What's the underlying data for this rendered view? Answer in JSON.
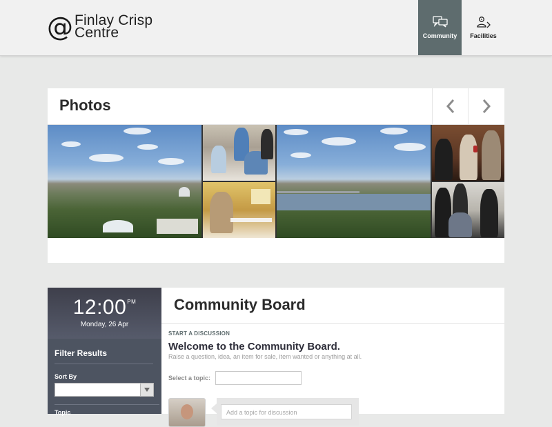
{
  "header": {
    "logo_symbol": "@",
    "logo_line1": "Finlay Crisp",
    "logo_line2": "Centre",
    "nav": [
      {
        "label": "Community",
        "icon": "speech-bubbles-icon",
        "active": true
      },
      {
        "label": "Facilities",
        "icon": "person-pin-icon",
        "active": false
      }
    ]
  },
  "photos": {
    "title": "Photos",
    "prev_icon": "chevron-left-icon",
    "next_icon": "chevron-right-icon"
  },
  "sidebar": {
    "time": "12:00",
    "ampm": "PM",
    "date": "Monday, 26 Apr",
    "filter_title": "Filter Results",
    "sort_by_label": "Sort By",
    "sort_by_value": "",
    "topic_label": "Topic"
  },
  "board": {
    "title": "Community Board",
    "start_label": "START A DISCUSSION",
    "welcome": "Welcome to the Community Board.",
    "welcome_sub": "Raise a question, idea, an item for sale, item wanted or anything at all.",
    "select_topic_label": "Select a topic:",
    "select_topic_value": "",
    "discussion_placeholder": "Add a topic for discussion"
  },
  "colors": {
    "nav_active": "#5e6c6e",
    "sidebar_bg": "#4d5461",
    "page_bg": "#e8e9e8"
  }
}
